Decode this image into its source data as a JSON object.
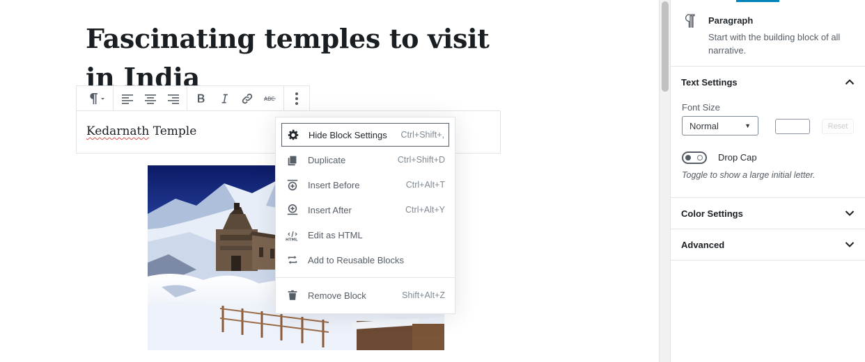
{
  "post": {
    "title": "Fascinating temples to visit in India",
    "paragraph_prefix": "Kedarnath",
    "paragraph_suffix": " Temple"
  },
  "toolbar": {
    "buttons": [
      "paragraph-switcher",
      "align-left",
      "align-center",
      "align-right",
      "bold",
      "italic",
      "link",
      "strikethrough",
      "more-options"
    ]
  },
  "menu": {
    "items": [
      {
        "label": "Hide Block Settings",
        "shortcut": "Ctrl+Shift+,",
        "icon": "gear-icon"
      },
      {
        "label": "Duplicate",
        "shortcut": "Ctrl+Shift+D",
        "icon": "duplicate-icon"
      },
      {
        "label": "Insert Before",
        "shortcut": "Ctrl+Alt+T",
        "icon": "insert-before-icon"
      },
      {
        "label": "Insert After",
        "shortcut": "Ctrl+Alt+Y",
        "icon": "insert-after-icon"
      },
      {
        "label": "Edit as HTML",
        "shortcut": "",
        "icon": "html-icon"
      },
      {
        "label": "Add to Reusable Blocks",
        "shortcut": "",
        "icon": "reusable-icon"
      },
      {
        "label": "Remove Block",
        "shortcut": "Shift+Alt+Z",
        "icon": "trash-icon"
      }
    ]
  },
  "sidebar": {
    "card": {
      "title": "Paragraph",
      "description": "Start with the building block of all narrative."
    },
    "text_settings": {
      "title": "Text Settings",
      "font_size_label": "Font Size",
      "font_size_value": "Normal",
      "reset_label": "Reset",
      "drop_cap_label": "Drop Cap",
      "drop_cap_help": "Toggle to show a large initial letter."
    },
    "color_settings": {
      "title": "Color Settings"
    },
    "advanced": {
      "title": "Advanced"
    }
  },
  "colors": {
    "accent": "#0085ba",
    "text": "#191e23",
    "muted": "#555d66",
    "border": "#e2e4e7"
  }
}
